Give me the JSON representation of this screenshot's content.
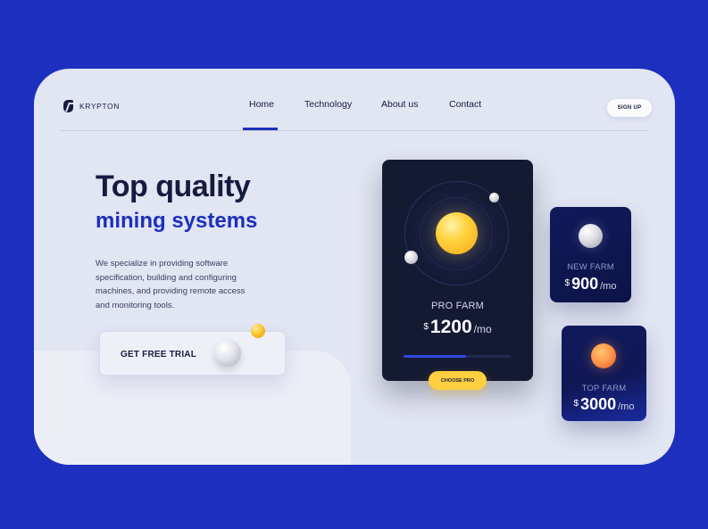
{
  "brand": {
    "name": "KRYPTON",
    "logo_icon": "krypton-k-logo-icon"
  },
  "nav": {
    "items": [
      {
        "label": "Home",
        "active": true
      },
      {
        "label": "Technology"
      },
      {
        "label": "About us"
      },
      {
        "label": "Contact"
      }
    ],
    "signup_label": "SIGN UP"
  },
  "hero": {
    "title": "Top quality",
    "subtitle": "mining systems",
    "description": "We specialize in providing software specification, building and configuring machines, and providing remote access and monitoring tools.",
    "cta_label": "GET FREE TRIAL"
  },
  "plans": {
    "pro": {
      "name": "PRO FARM",
      "currency": "$",
      "price": "1200",
      "period": "/mo",
      "progress": 0.58,
      "button_label": "CHOOSE PRO"
    },
    "new": {
      "name": "NEW FARM",
      "currency": "$",
      "price": "900",
      "period": "/mo"
    },
    "top": {
      "name": "TOP FARM",
      "currency": "$",
      "price": "3000",
      "period": "/mo"
    }
  },
  "colors": {
    "accent": "#1c2fbe",
    "dark": "#161c3f",
    "card_dark": "#151a33",
    "gold": "#ffcf3f",
    "page_bg": "#e2e5f2"
  }
}
